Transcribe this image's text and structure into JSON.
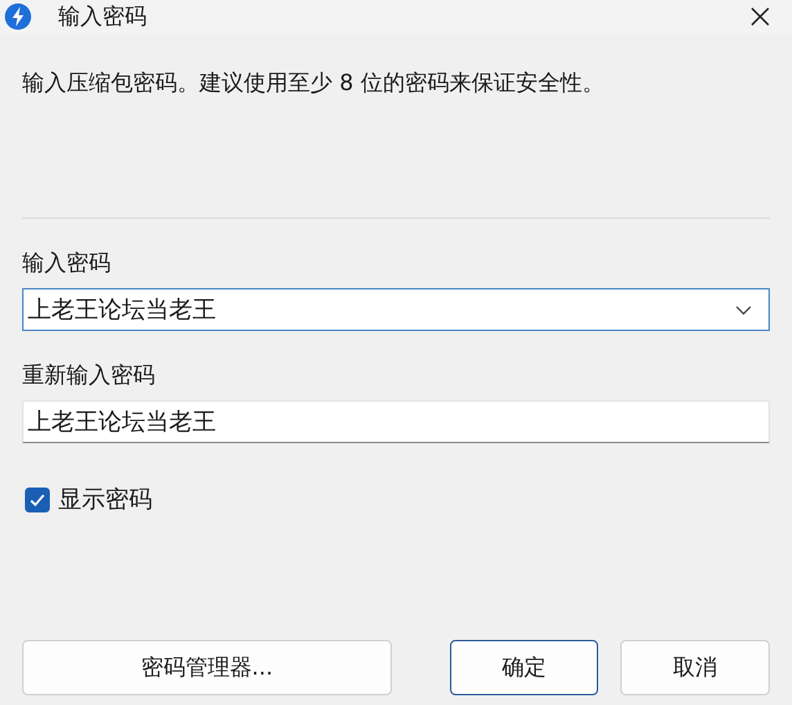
{
  "window": {
    "title": "输入密码"
  },
  "description": "输入压缩包密码。建议使用至少 8 位的密码来保证安全性。",
  "fields": [
    {
      "kind": "combo",
      "label": "输入密码",
      "value": "上老王论坛当老王",
      "focused": true
    },
    {
      "kind": "text",
      "label": "重新输入密码",
      "value": "上老王论坛当老王",
      "focused": false
    }
  ],
  "show_password": {
    "label": "显示密码",
    "checked": true
  },
  "buttons": [
    {
      "label": "密码管理器...",
      "default": false
    },
    {
      "label": "确定",
      "default": true
    },
    {
      "label": "取消",
      "default": false
    }
  ]
}
